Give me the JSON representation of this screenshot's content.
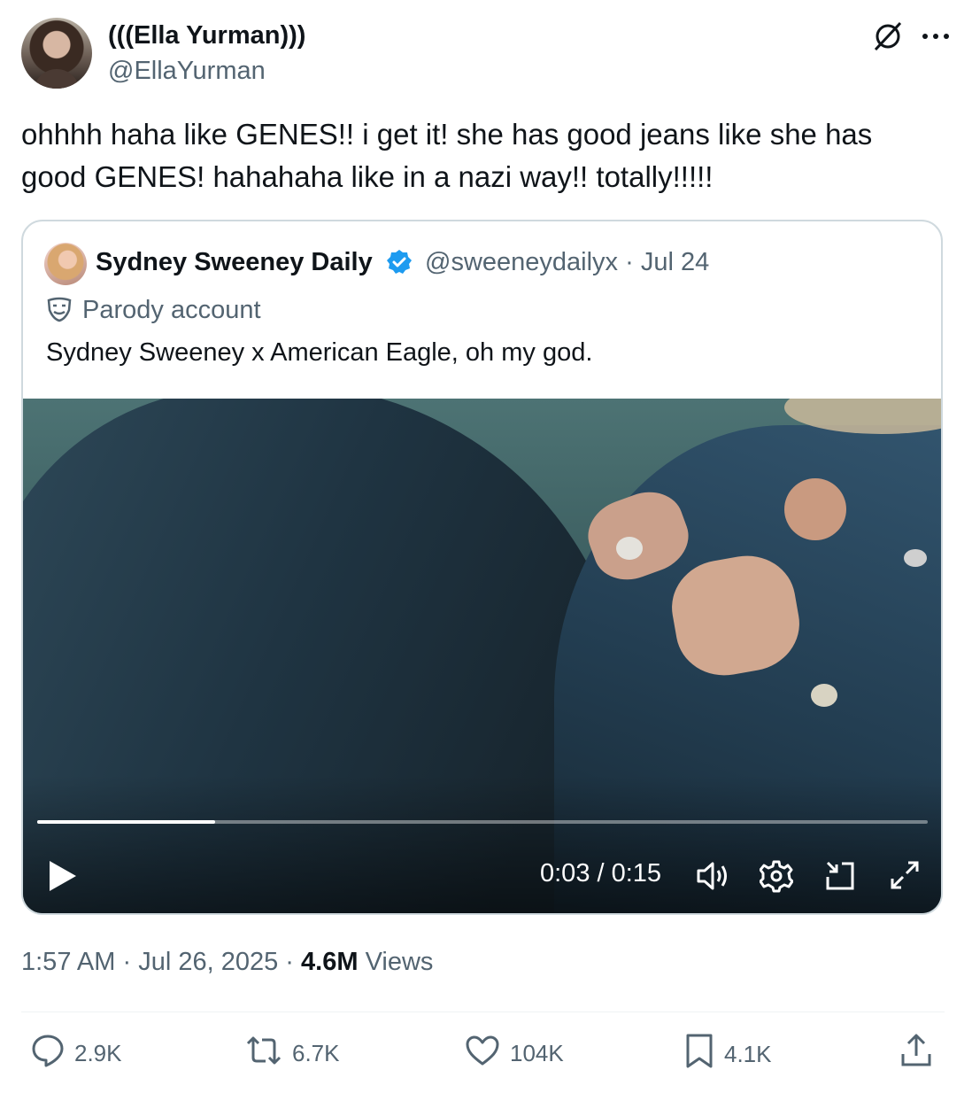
{
  "author": {
    "display_name": "(((Ella Yurman)))",
    "handle": "@EllaYurman"
  },
  "tweet": {
    "text": "ohhhh haha like GENES!! i get it! she has good jeans like she has good GENES! hahahaha like in a nazi way!! totally!!!!!"
  },
  "quote": {
    "display_name": "Sydney Sweeney Daily",
    "handle": "@sweeneydailyx",
    "date_separator": "·",
    "date": "Jul 24",
    "parody_label": "Parody account",
    "text": "Sydney Sweeney x American Eagle, oh my god.",
    "video": {
      "time": "0:03 / 0:15",
      "progress": 0.2
    }
  },
  "meta": {
    "time": "1:57 AM",
    "sep1": "·",
    "date": "Jul 26, 2025",
    "sep2": "·",
    "views_count": "4.6M",
    "views_label": "Views"
  },
  "actions": {
    "replies": "2.9K",
    "reposts": "6.7K",
    "likes": "104K",
    "bookmarks": "4.1K"
  },
  "icons": [
    "grok-icon",
    "more-icon",
    "verified-icon",
    "parody-mask-icon",
    "play-icon",
    "volume-icon",
    "settings-icon",
    "pip-icon",
    "fullscreen-icon",
    "reply-icon",
    "repost-icon",
    "like-icon",
    "bookmark-icon",
    "share-icon"
  ],
  "colors": {
    "text": "#0f1419",
    "secondary": "#536471",
    "verified": "#1d9bf0",
    "border": "#cfd9de"
  }
}
